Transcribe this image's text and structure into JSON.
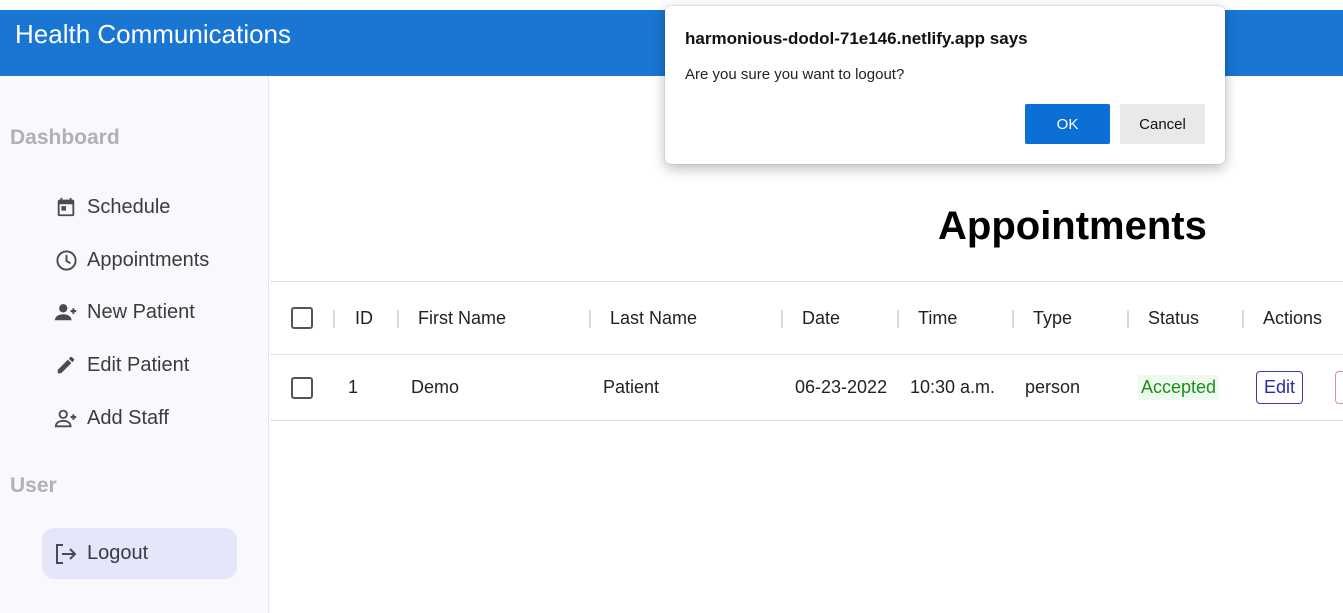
{
  "appbar": {
    "title": "Health Communications"
  },
  "sidebar": {
    "sections": [
      {
        "label": "Dashboard"
      },
      {
        "label": "User"
      }
    ],
    "items": [
      {
        "label": "Schedule",
        "icon": "calendar-icon"
      },
      {
        "label": "Appointments",
        "icon": "clock-icon"
      },
      {
        "label": "New Patient",
        "icon": "person-add-icon"
      },
      {
        "label": "Edit Patient",
        "icon": "pencil-icon"
      },
      {
        "label": "Add Staff",
        "icon": "person-add-outline-icon"
      },
      {
        "label": "Logout",
        "icon": "logout-icon",
        "active": true
      }
    ]
  },
  "main": {
    "heading": "Appointments",
    "table": {
      "columns": [
        "ID",
        "First Name",
        "Last Name",
        "Date",
        "Time",
        "Type",
        "Status",
        "Actions"
      ],
      "rows": [
        {
          "id": "1",
          "first_name": "Demo",
          "last_name": "Patient",
          "date": "06-23-2022",
          "time": "10:30 a.m.",
          "type": "person",
          "status": "Accepted",
          "edit_label": "Edit"
        }
      ]
    }
  },
  "dialog": {
    "title": "harmonious-dodol-71e146.netlify.app says",
    "message": "Are you sure you want to logout?",
    "ok_label": "OK",
    "cancel_label": "Cancel"
  },
  "colors": {
    "appbar": "#1976d2",
    "sidebar_bg": "#f8f8fd",
    "active_item": "#e5e6fa",
    "status_accepted": "#1a8f1a",
    "ok_button": "#0b6fd6"
  }
}
